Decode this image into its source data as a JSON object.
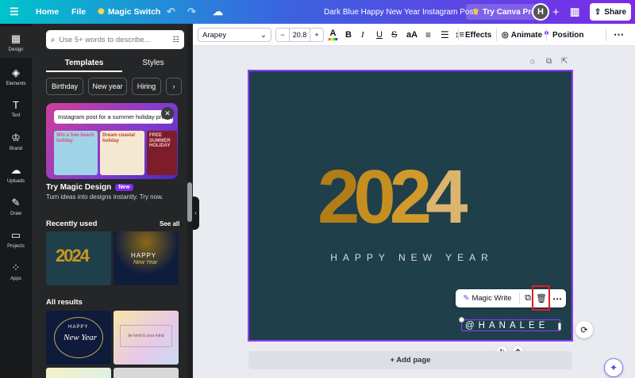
{
  "topbar": {
    "menu_icon": "hamburger-icon",
    "home": "Home",
    "file": "File",
    "magic_switch": "Magic Switch",
    "doc_title": "Dark Blue Happy New Year Instagram Post",
    "try_pro": "Try Canva Pro",
    "avatar_initial": "H",
    "share": "Share"
  },
  "rail": [
    {
      "label": "Design",
      "icon": "design-icon"
    },
    {
      "label": "Elements",
      "icon": "elements-icon"
    },
    {
      "label": "Text",
      "icon": "text-icon"
    },
    {
      "label": "Brand",
      "icon": "brand-icon"
    },
    {
      "label": "Uploads",
      "icon": "uploads-icon"
    },
    {
      "label": "Draw",
      "icon": "draw-icon"
    },
    {
      "label": "Projects",
      "icon": "projects-icon"
    },
    {
      "label": "Apps",
      "icon": "apps-icon"
    }
  ],
  "panel": {
    "search_placeholder": "Use 5+ words to describe...",
    "tab_templates": "Templates",
    "tab_styles": "Styles",
    "chips": [
      "Birthday",
      "New year",
      "Hiring"
    ],
    "promo_prompt": "Instagram post for a summer holiday promo",
    "promo_mini1": "Win a free beach holiday",
    "promo_mini2": "Dream coastal holiday",
    "promo_mini3": "FREE SUMMER HOLIDAY",
    "promo_title": "Try Magic Design",
    "promo_badge": "New",
    "promo_desc": "Turn ideas into designs instantly. Try now.",
    "recent_title": "Recently used",
    "see_all": "See all",
    "recent1_year": "2024",
    "recent2_text1": "HAPPY",
    "recent2_text2": "New Year",
    "all_results": "All results",
    "result1_text1": "HAPPY",
    "result1_text2": "New Year",
    "result2_text": "be kind to your mind"
  },
  "toolbar": {
    "font": "Arapey",
    "size": "20.8",
    "effects": "Effects",
    "animate": "Animate",
    "position": "Position"
  },
  "canvas": {
    "year_digits": [
      "2",
      "0",
      "2",
      "4"
    ],
    "headline": "HAPPY NEW YEAR",
    "handle_text": "@HANALEE",
    "bg_color": "#1f3f4b",
    "gold": "#c08a1e",
    "light_gold": "#d9b06a"
  },
  "context_menu": {
    "magic_write": "Magic Write"
  },
  "add_page": "+ Add page"
}
